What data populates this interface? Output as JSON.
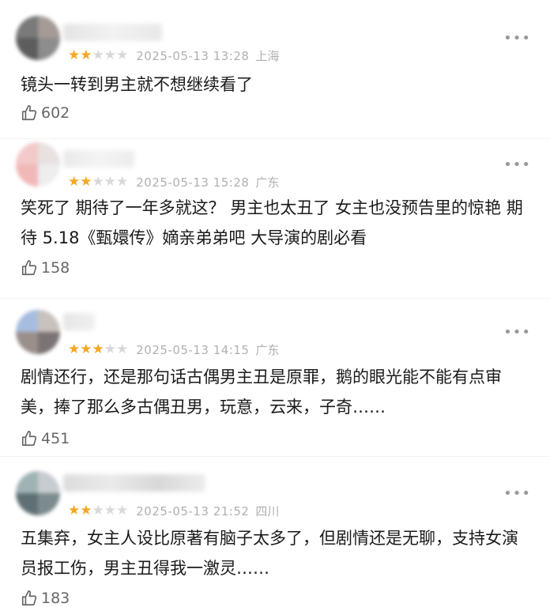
{
  "comments": [
    {
      "rating": 2,
      "time": "2025-05-13 13:28",
      "location": "上海",
      "text": "镜头一转到男主就不想继续看了",
      "likes": "602",
      "avatar_colors": [
        "#7a7a7a",
        "#a59a96",
        "#5d5d5d",
        "#8d8d8d"
      ]
    },
    {
      "rating": 2,
      "time": "2025-05-13 15:28",
      "location": "广东",
      "text": "笑死了 期待了一年多就这？ 男主也太丑了 女主也没预告里的惊艳 期待 5.18《甄嬛传》嫡亲弟弟吧 大导演的剧必看",
      "likes": "158",
      "avatar_colors": [
        "#f3c9c9",
        "#e9e0e0",
        "#f1b8b8",
        "#eeeeee"
      ]
    },
    {
      "rating": 3,
      "time": "2025-05-13 14:15",
      "location": "广东",
      "text": "剧情还行，还是那句话古偶男主丑是原罪，鹅的眼光能不能有点审美，捧了那么多古偶丑男，玩意，云来，子奇……",
      "likes": "451",
      "avatar_colors": [
        "#a7bde0",
        "#c9c1bd",
        "#9a8f8b",
        "#7b7474"
      ]
    },
    {
      "rating": 2,
      "time": "2025-05-13 21:52",
      "location": "四川",
      "text": "五集弃，女主人设比原著有脑子太多了，但剧情还是无聊，支持女演员报工伤，男主丑得我一激灵……",
      "likes": "183",
      "avatar_colors": [
        "#9fb3b5",
        "#c7ccd0",
        "#5f7074",
        "#7d8b8f"
      ]
    }
  ],
  "more_icon": "ellipsis-icon",
  "like_icon": "thumbs-up-icon",
  "colors": {
    "star_on": "#f5a623",
    "star_off": "#d9d9d9",
    "meta": "#b0b0b0"
  }
}
